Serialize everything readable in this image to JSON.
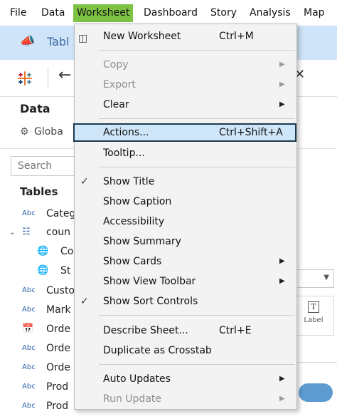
{
  "menubar": {
    "items": [
      {
        "id": "file",
        "label": "File"
      },
      {
        "id": "data",
        "label": "Data"
      },
      {
        "id": "worksheet",
        "label": "Worksheet"
      },
      {
        "id": "dashboard",
        "label": "Dashboard"
      },
      {
        "id": "story",
        "label": "Story"
      },
      {
        "id": "analysis",
        "label": "Analysis"
      },
      {
        "id": "map",
        "label": "Map"
      }
    ],
    "active": "Worksheet"
  },
  "banner": {
    "title": "Tabl",
    "icon": "megaphone-icon"
  },
  "toolbar": {
    "logo_icon": "tableau-logo-icon",
    "back_icon": "back-arrow-icon"
  },
  "data_pane": {
    "title": "Data",
    "source": "Globa",
    "search_placeholder": "Search",
    "tables_heading": "Tables",
    "fields": [
      {
        "type": "Abc",
        "name": "Categ"
      },
      {
        "type": "group",
        "name": "coun"
      },
      {
        "type": "globe",
        "name": "Co"
      },
      {
        "type": "globe",
        "name": "St"
      },
      {
        "type": "Abc",
        "name": "Custo"
      },
      {
        "type": "Abc",
        "name": "Mark"
      },
      {
        "type": "date",
        "name": "Orde"
      },
      {
        "type": "Abc",
        "name": "Orde"
      },
      {
        "type": "Abc",
        "name": "Orde"
      },
      {
        "type": "Abc",
        "name": "Prod"
      },
      {
        "type": "Abc",
        "name": "Prod"
      }
    ]
  },
  "marks_card": {
    "label_button": "Label"
  },
  "worksheet_menu": {
    "new_worksheet": {
      "label": "New Worksheet",
      "shortcut": "Ctrl+M"
    },
    "copy": {
      "label": "Copy"
    },
    "export": {
      "label": "Export"
    },
    "clear": {
      "label": "Clear"
    },
    "actions": {
      "label": "Actions...",
      "shortcut": "Ctrl+Shift+A"
    },
    "tooltip": {
      "label": "Tooltip..."
    },
    "show_title": {
      "label": "Show Title",
      "checked": true
    },
    "show_caption": {
      "label": "Show Caption"
    },
    "accessibility": {
      "label": "Accessibility"
    },
    "show_summary": {
      "label": "Show Summary"
    },
    "show_cards": {
      "label": "Show Cards"
    },
    "show_view_toolbar": {
      "label": "Show View Toolbar"
    },
    "show_sort_controls": {
      "label": "Show Sort Controls",
      "checked": true
    },
    "describe_sheet": {
      "label": "Describe Sheet...",
      "shortcut": "Ctrl+E"
    },
    "duplicate_crosstab": {
      "label": "Duplicate as Crosstab"
    },
    "auto_updates": {
      "label": "Auto Updates"
    },
    "run_update": {
      "label": "Run Update"
    }
  },
  "colors": {
    "menu_active": "#7ec244",
    "banner": "#cfe4f8",
    "highlight": "#cfe6f9",
    "highlight_border": "#183a52"
  }
}
